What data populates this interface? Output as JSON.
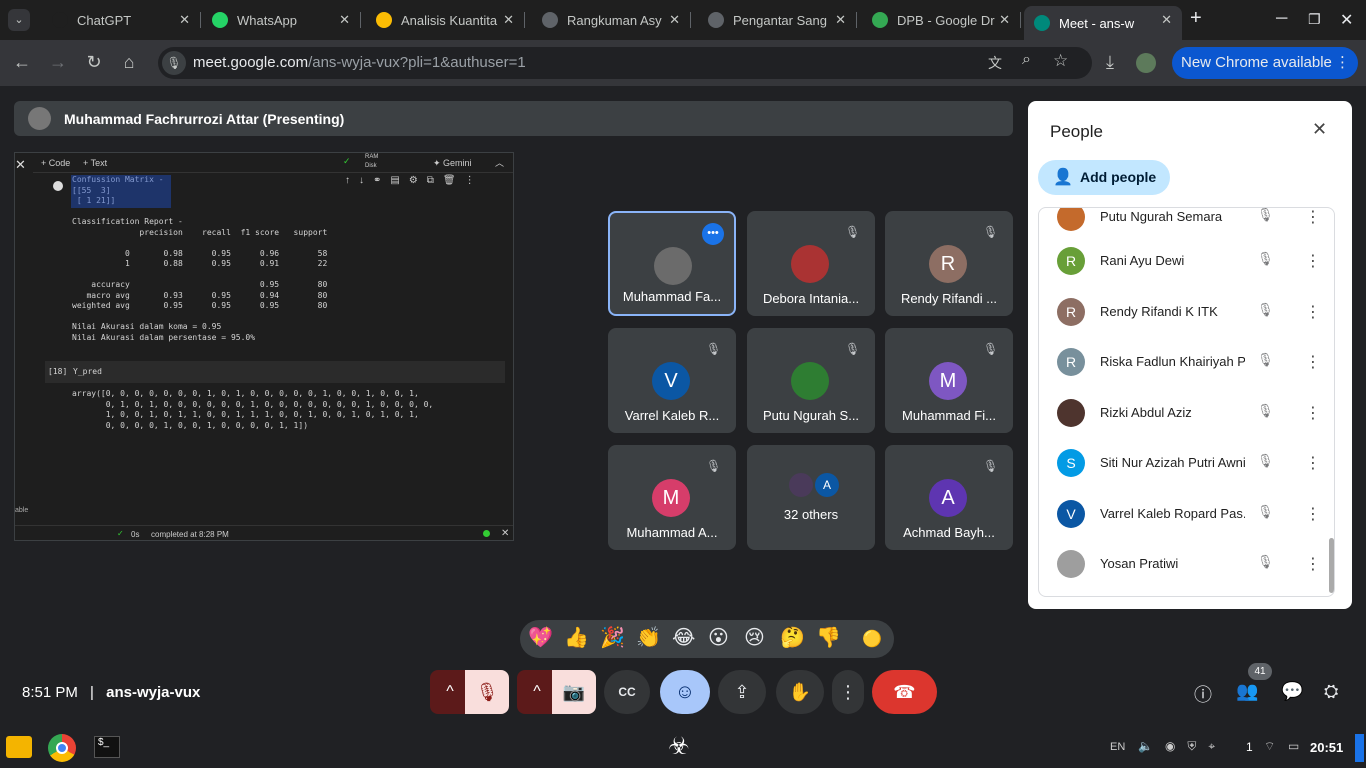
{
  "tabs": [
    {
      "title": "ChatGPT",
      "color": "#1f1f1f"
    },
    {
      "title": "WhatsApp",
      "color": "#25d366"
    },
    {
      "title": "Analisis Kuantita",
      "color": "#fbbc04"
    },
    {
      "title": "Rangkuman Asy",
      "color": "#5f6368"
    },
    {
      "title": "Pengantar Sang",
      "color": "#5f6368"
    },
    {
      "title": "DPB - Google Dr",
      "color": "#34a853"
    },
    {
      "title": "Meet - ans-w",
      "color": "#00897b"
    }
  ],
  "url": {
    "host": "meet.google.com",
    "path": "/ans-wyja-vux?pli=1&authuser=1"
  },
  "new_chrome": "New Chrome available",
  "presenter": "Muhammad Fachrurrozi Attar (Presenting)",
  "notebook": {
    "code_btn": "+ Code",
    "text_btn": "+ Text",
    "ram": "RAM",
    "disk": "Disk",
    "gemini": "✦ Gemini",
    "output1": "Confussion Matrix -\n[[55  3]\n [ 1 21]]\n\nClassification Report -\n              precision    recall  f1 score   support\n\n           0       0.98      0.95      0.96        58\n           1       0.88      0.95      0.91        22\n\n    accuracy                           0.95        80\n   macro avg       0.93      0.95      0.94        80\nweighted avg       0.95      0.95      0.95        80\n\nNilai Akurasi dalam koma = 0.95\nNilai Akurasi dalam persentase = 95.0%",
    "cell_num": "[18]",
    "cell_code": "Y_pred",
    "output2": "array([0, 0, 0, 0, 0, 0, 0, 1, 0, 1, 0, 0, 0, 0, 0, 1, 0, 0, 1, 0, 0, 1,\n       0, 1, 0, 1, 0, 0, 0, 0, 0, 0, 1, 0, 0, 0, 0, 0, 0, 0, 1, 0, 0, 0, 0,\n       1, 0, 0, 1, 0, 1, 1, 0, 0, 1, 1, 1, 0, 0, 1, 0, 0, 1, 0, 1, 0, 1,\n       0, 0, 0, 0, 1, 0, 0, 1, 0, 0, 0, 0, 1, 1])",
    "status_time": "0s",
    "status": "completed at 8:28 PM",
    "side_label": "able"
  },
  "tiles": [
    {
      "name": "Muhammad Fa...",
      "initial": "",
      "color": "#6b6b6b"
    },
    {
      "name": "Debora Intania...",
      "initial": "",
      "color": "#a33"
    },
    {
      "name": "Rendy Rifandi ...",
      "initial": "R",
      "color": "#8d6e63"
    },
    {
      "name": "Varrel Kaleb R...",
      "initial": "V",
      "color": "#0b57a4"
    },
    {
      "name": "Putu Ngurah S...",
      "initial": "",
      "color": "#2e7d32"
    },
    {
      "name": "Muhammad Fi...",
      "initial": "M",
      "color": "#7e57c2"
    },
    {
      "name": "Muhammad A...",
      "initial": "M",
      "color": "#d63d6a"
    },
    {
      "name": "32 others",
      "initial": "A",
      "color": "#0b57a4"
    },
    {
      "name": "Achmad Bayh...",
      "initial": "A",
      "color": "#5e35b1"
    }
  ],
  "people": {
    "title": "People",
    "add": "Add people",
    "list": [
      {
        "name": "Putu Ngurah Semara",
        "initial": "",
        "color": "#c46a2c"
      },
      {
        "name": "Rani Ayu Dewi",
        "initial": "R",
        "color": "#689f38"
      },
      {
        "name": "Rendy Rifandi K ITK",
        "initial": "R",
        "color": "#8d6e63"
      },
      {
        "name": "Riska Fadlun Khairiyah P...",
        "initial": "R",
        "color": "#78909c"
      },
      {
        "name": "Rizki Abdul Aziz",
        "initial": "",
        "color": "#4e342e"
      },
      {
        "name": "Siti Nur Azizah Putri Awni",
        "initial": "S",
        "color": "#039be5"
      },
      {
        "name": "Varrel Kaleb Ropard Pas...",
        "initial": "V",
        "color": "#0b57a4"
      },
      {
        "name": "Yosan Pratiwi",
        "initial": "",
        "color": "#9e9e9e"
      }
    ]
  },
  "reactions": [
    "💖",
    "👍",
    "🎉",
    "👏",
    "😂",
    "😮",
    "😢",
    "🤔",
    "👎",
    "🟡"
  ],
  "meeting": {
    "time": "8:51 PM",
    "sep": "|",
    "code": "ans-wyja-vux",
    "people_count": "41"
  },
  "taskbar": {
    "lang": "EN",
    "clock": "20:51",
    "notif": "1"
  }
}
